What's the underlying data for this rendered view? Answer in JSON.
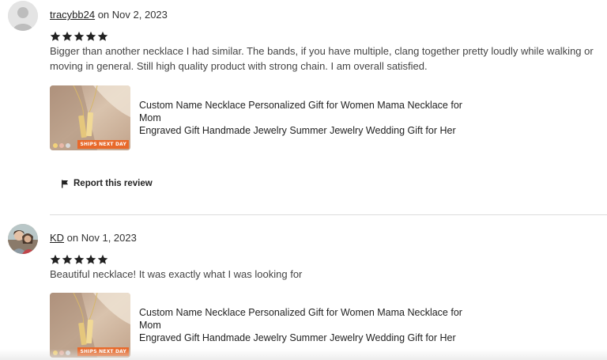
{
  "reviews": [
    {
      "username": "tracybb24",
      "date_text": " on Nov 2, 2023",
      "rating": 5,
      "text": "Bigger than another necklace I had similar. The bands, if you have multiple, clang together pretty loudly while walking or moving in general. Still high quality product with strong chain. I am overall satisfied.",
      "product": {
        "title_line1": "Custom Name Necklace Personalized Gift for Women Mama Necklace for Mom",
        "title_line2": "Engraved Gift Handmade Jewelry Summer Jewelry Wedding Gift for Her",
        "badge": "SHIPS NEXT DAY"
      },
      "report_label": "Report this review"
    },
    {
      "username": "KD",
      "date_text": " on Nov 1, 2023",
      "rating": 5,
      "text": "Beautiful necklace! It was exactly what I was looking for",
      "product": {
        "title_line1": "Custom Name Necklace Personalized Gift for Women Mama Necklace for Mom",
        "title_line2": "Engraved Gift Handmade Jewelry Summer Jewelry Wedding Gift for Her",
        "badge": "SHIPS NEXT DAY"
      }
    }
  ],
  "icons": {
    "star": "star-icon",
    "flag": "flag-icon",
    "avatar_placeholder": "user-silhouette-icon"
  },
  "colors": {
    "star": "#222222",
    "badge": "#e8692a",
    "divider": "#dcdcdc"
  }
}
